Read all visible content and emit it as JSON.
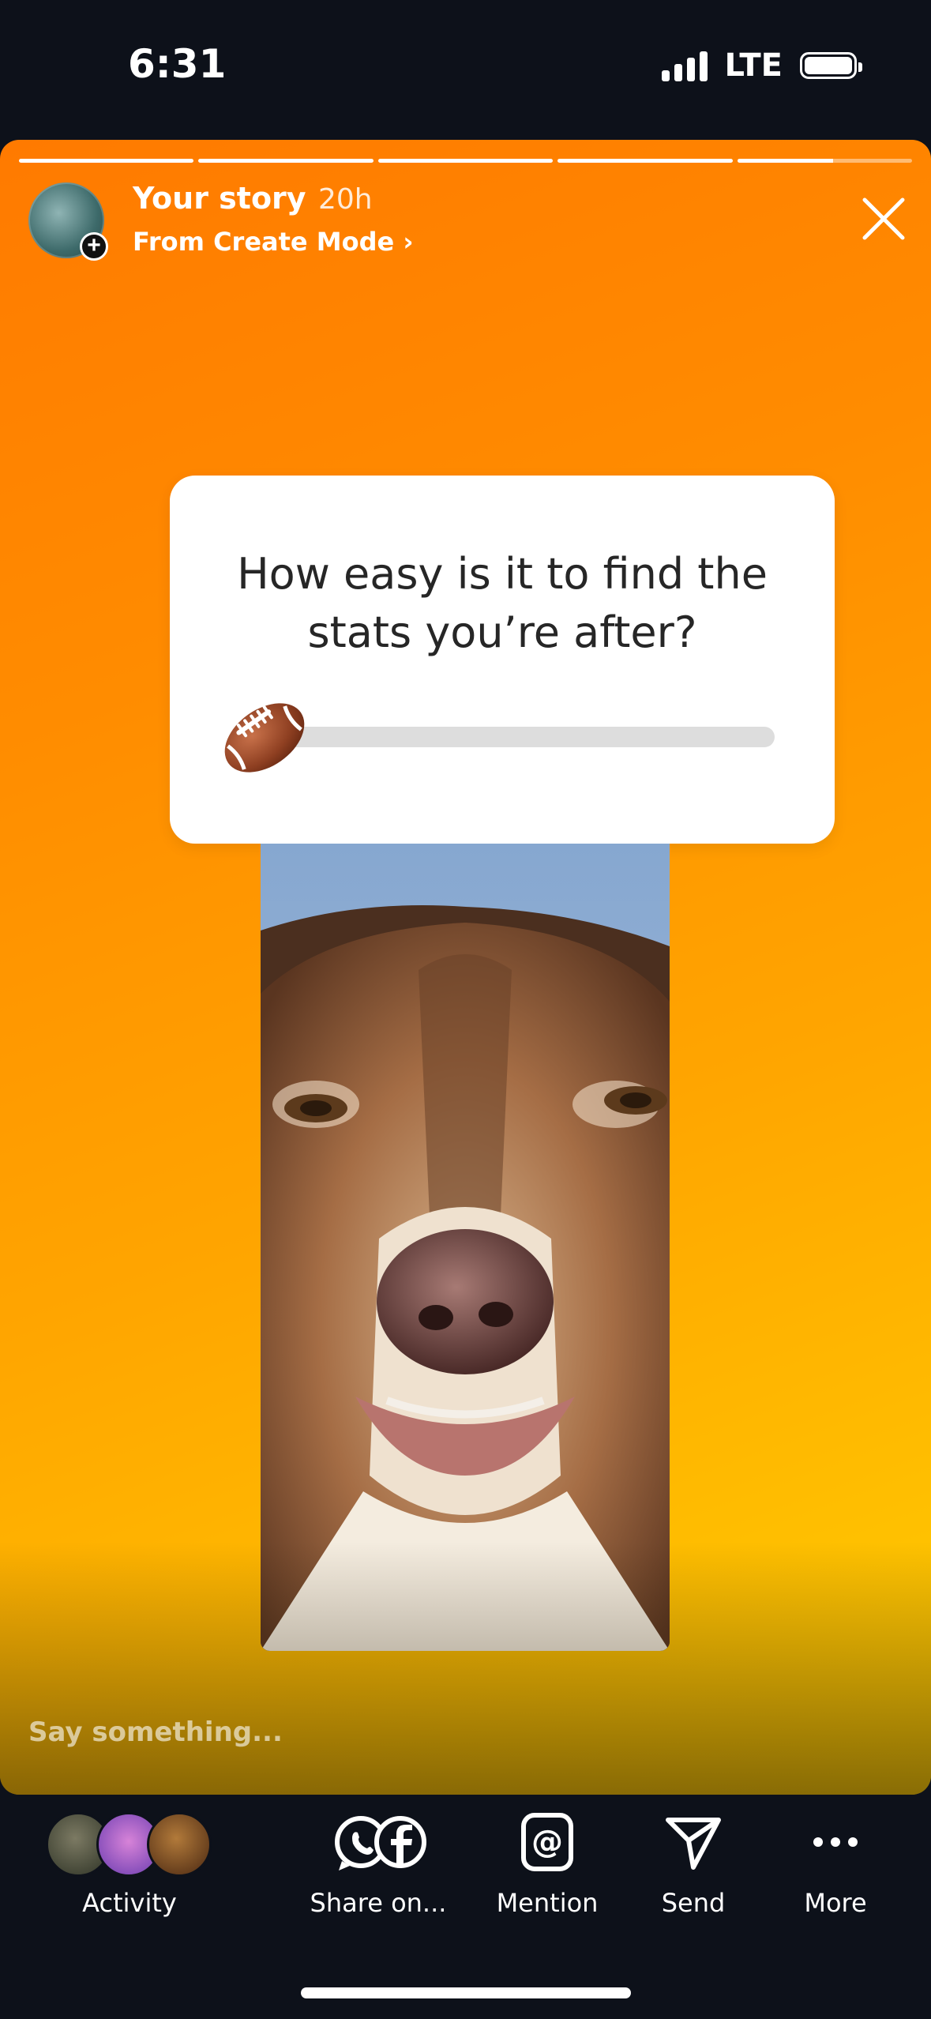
{
  "status_bar": {
    "time": "6:31",
    "network": "LTE",
    "signal_bars": 4
  },
  "story": {
    "user": "Your story",
    "time_ago": "20h",
    "subtitle": "From Create Mode ›",
    "progress": [
      1,
      1,
      1,
      1,
      0.55
    ],
    "gradient_colors": [
      "#ff7a00",
      "#ffcd00"
    ]
  },
  "sticker": {
    "question": "How easy is it to find the stats you’re after?",
    "emoji": "american-football-icon",
    "slider_value": 0
  },
  "reply": {
    "placeholder": "Say something..."
  },
  "actions": {
    "activity": "Activity",
    "share": "Share on...",
    "mention": "Mention",
    "send": "Send",
    "more": "More"
  }
}
